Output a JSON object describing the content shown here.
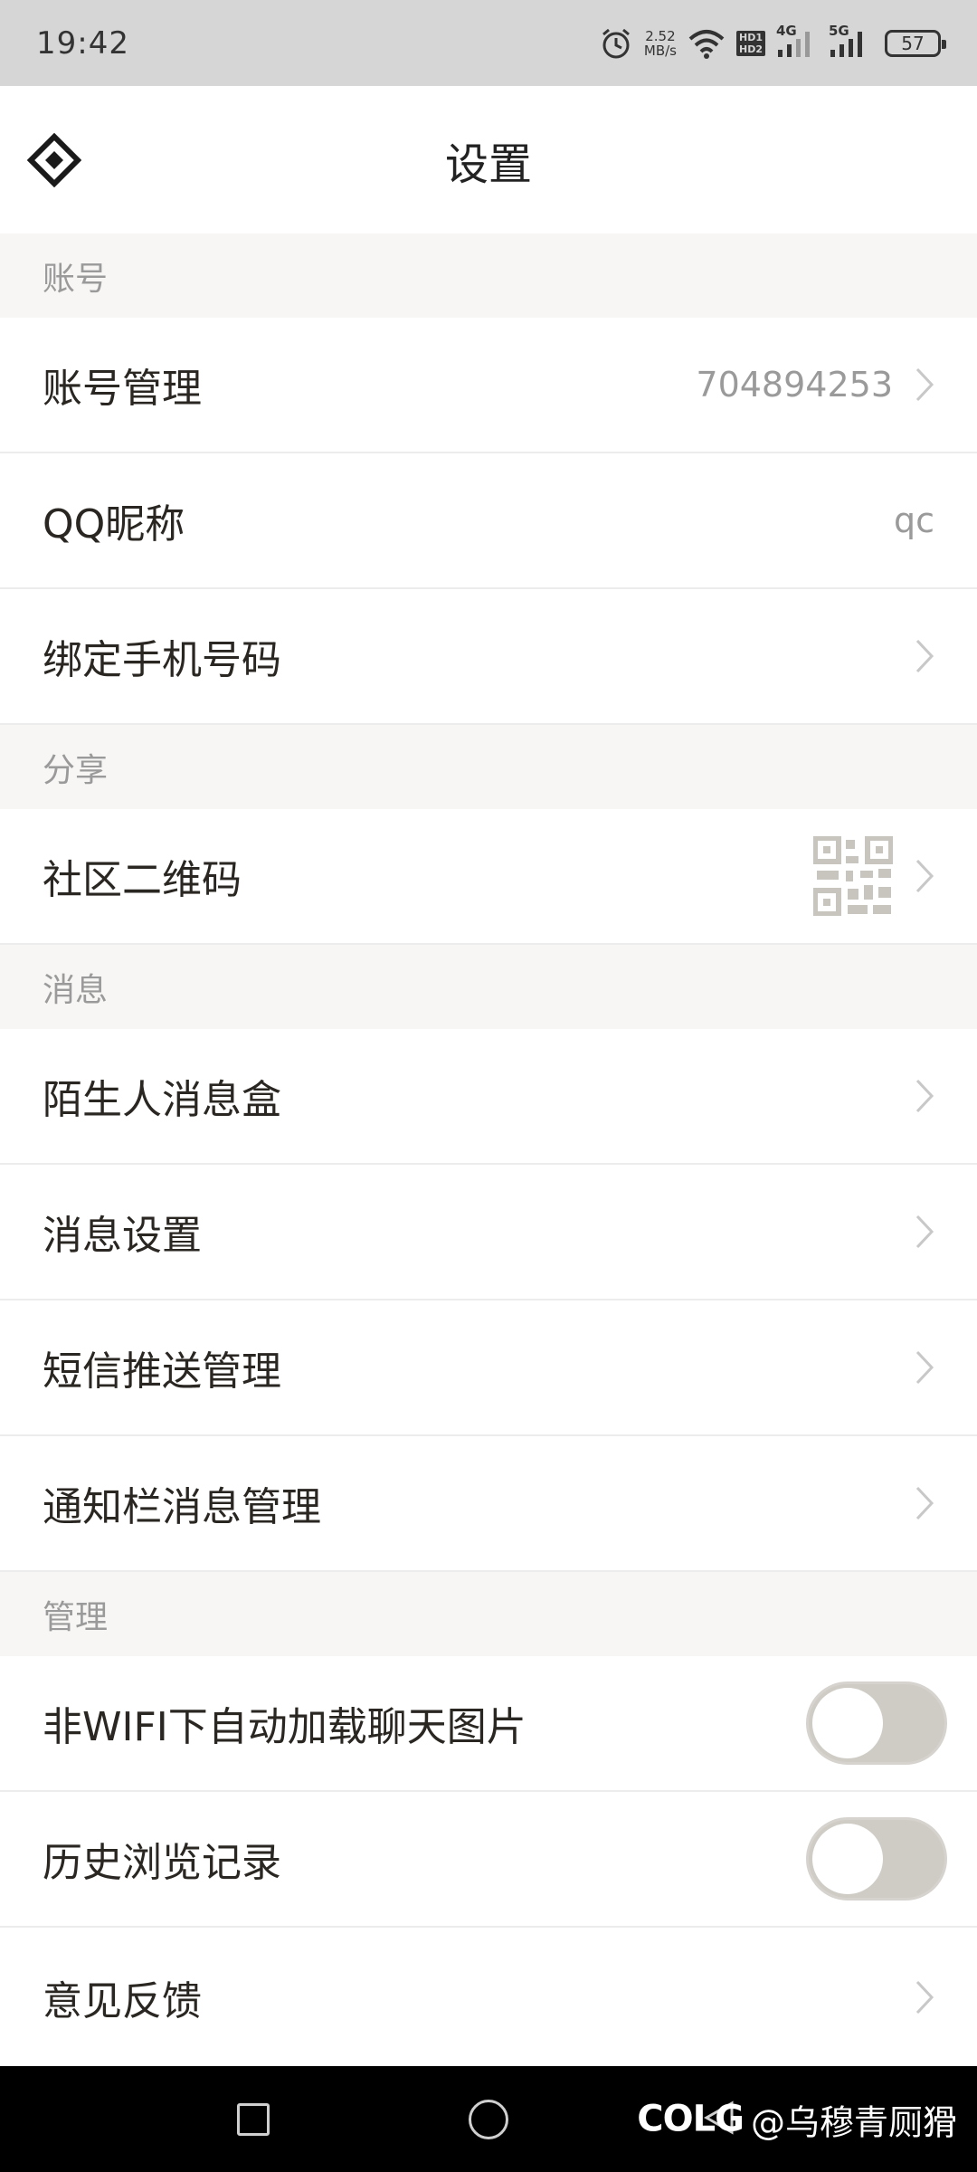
{
  "status_bar": {
    "time": "19:42",
    "speed_value": "2.52",
    "speed_unit": "MB/s",
    "hd1": "HD1",
    "hd2": "HD2",
    "net1": "4G",
    "net2": "5G",
    "battery": "57",
    "icons": [
      "alarm-icon",
      "wifi-icon",
      "signal-icon",
      "battery-icon"
    ]
  },
  "header": {
    "title": "设置",
    "logo_icon": "diamond-logo-icon"
  },
  "sections": {
    "account": {
      "title": "账号",
      "items": [
        {
          "label": "账号管理",
          "value": "704894253"
        },
        {
          "label": "QQ昵称",
          "value": "qc"
        },
        {
          "label": "绑定手机号码",
          "value": ""
        }
      ]
    },
    "share": {
      "title": "分享",
      "items": [
        {
          "label": "社区二维码"
        }
      ]
    },
    "message": {
      "title": "消息",
      "items": [
        {
          "label": "陌生人消息盒"
        },
        {
          "label": "消息设置"
        },
        {
          "label": "短信推送管理"
        },
        {
          "label": "通知栏消息管理"
        }
      ]
    },
    "manage": {
      "title": "管理",
      "items": [
        {
          "label": "非WIFI下自动加载聊天图片",
          "toggle_on": false
        },
        {
          "label": "历史浏览记录",
          "toggle_on": false
        },
        {
          "label": "意见反馈"
        }
      ]
    }
  },
  "nav_bar": {
    "watermark_brand": "COLG",
    "watermark_user": "@乌穆青厕猾"
  },
  "colors": {
    "status_bg": "#d6d6d6",
    "section_bg": "#f7f6f4",
    "toggle_off": "#cfccc6",
    "nav_bg": "#000000"
  }
}
